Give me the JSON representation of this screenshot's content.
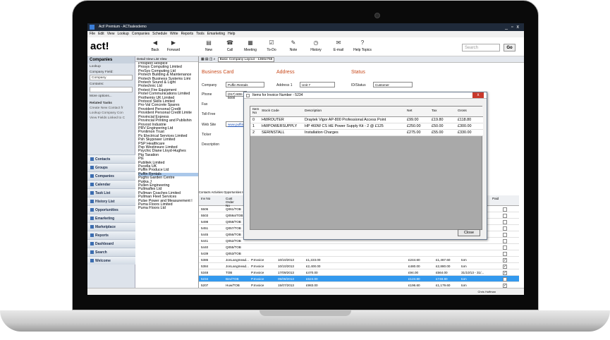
{
  "window": {
    "title": "Act! Premium - ACTsalesdemo"
  },
  "menu": [
    "File",
    "Edit",
    "View",
    "Lookup",
    "Companies",
    "Schedule",
    "Write",
    "Reports",
    "Tools",
    "Emarketing",
    "Help"
  ],
  "toolbar": {
    "logo": "act!",
    "buttons": [
      {
        "label": "Back",
        "icon": "back-arrow-icon"
      },
      {
        "label": "Forward",
        "icon": "forward-arrow-icon"
      },
      {
        "label": "New",
        "icon": "new-document-icon"
      },
      {
        "label": "Call",
        "icon": "phone-icon"
      },
      {
        "label": "Meeting",
        "icon": "meeting-icon"
      },
      {
        "label": "To-Do",
        "icon": "todo-icon"
      },
      {
        "label": "Note",
        "icon": "note-icon"
      },
      {
        "label": "History",
        "icon": "history-icon"
      },
      {
        "label": "E-mail",
        "icon": "email-icon"
      },
      {
        "label": "Help Topics",
        "icon": "help-icon"
      }
    ],
    "search_placeholder": "Search",
    "go_label": "Go"
  },
  "leftnav": {
    "header": "Companies",
    "lookup_title": "Lookup",
    "company_field_label": "Company Field:",
    "company_field_value": "Company",
    "contains_label": "Contains:",
    "more_options": "More options...",
    "related_title": "Related Tasks",
    "related": [
      "Create New Contact fr",
      "Lookup Company Con",
      "View Fields Linked to C"
    ],
    "items": [
      "Contacts",
      "Groups",
      "Companies",
      "Calendar",
      "Task List",
      "History List",
      "Opportunities",
      "Emarketing",
      "Marketplace",
      "Reports",
      "Dashboard",
      "Search",
      "Welcome"
    ]
  },
  "companies": {
    "toolbar": "Detail View  List View",
    "list": [
      "Prospect Hospice",
      "Prosys Computing Limited",
      "ProSys Computing Ltd",
      "Protech Building & Maintenance",
      "Protech Business Systems Limi",
      "Protech Sound & Light",
      "Protechnic Ltd",
      "Protect Fire Equipment",
      "Protel Communications Limited",
      "Prothemis UK Limited",
      "Protocol Skills Limited",
      "Pro-Val Concrete Spares",
      "Provident Personal Credit",
      "Provident Personal Credit Limite",
      "Provincial Express",
      "Provincial Printing and Publishin",
      "Provost Industrie",
      "PRV Engineering Ltd",
      "Prvnlimon Trust",
      "Ps Electrical Services Limited",
      "Psh Skypower Limited",
      "PSP Healthcare",
      "Psp Westinsure Limited",
      "Psychic Diane Lloyd-Hughes",
      "Ptg Taxation",
      "Pts",
      "Publitek Limited",
      "Pucella UK",
      "Puffin Produce Ltd",
      "Puffin Rentals",
      "Pughs Garden Centre",
      "Pukka J",
      "Pullen Engineering",
      "Pullmaflex Ltd",
      "Pullman Coaches Limited",
      "Pullman Fleet Services",
      "Pulse Power and Measurement l",
      "Puma Floors Limited",
      "Puma Floors Ltd"
    ],
    "selected": "Puffin Rentals"
  },
  "detail": {
    "viewbar": "Basic Company Layout - 1366x768",
    "sections": [
      "Business Card",
      "Address",
      "Status"
    ],
    "fields": {
      "company_label": "Company",
      "company_value": "Puffin Rentals",
      "phone_label": "Phone",
      "phone_value": "(017) 608-5000",
      "fax_label": "Fax",
      "tollfree_label": "Toll-Free",
      "website_label": "Web Site",
      "website_value": "www.puffinrentals",
      "ticker_label": "Ticker",
      "description_label": "Description",
      "address1_label": "Address 1",
      "address1_value": "Unit 7",
      "idstatus_label": "ID/Status",
      "idstatus_value": "Customer"
    },
    "tabs": "Contacts  Activities  Opportunities  History",
    "grid_headers": [
      "Inv No",
      "Cust Order No",
      "Paid"
    ],
    "rows": [
      {
        "inv": "5506",
        "order": "Q061/TOB",
        "paid": false
      },
      {
        "inv": "5503",
        "order": "Q059a/TOB",
        "paid": false
      },
      {
        "inv": "5498",
        "order": "Q058/TOB",
        "paid": false
      },
      {
        "inv": "5451",
        "order": "Q057/TOB",
        "paid": false
      },
      {
        "inv": "5445",
        "order": "Q056/TOB",
        "paid": false
      },
      {
        "inv": "5441",
        "order": "Q052/TOB",
        "paid": false
      },
      {
        "inv": "5440",
        "order": "Q055/TOB",
        "paid": false
      },
      {
        "inv": "5439",
        "order": "Q053/TOB",
        "paid": false
      },
      {
        "inv": "5386",
        "order": "JonLangmead...",
        "type": "P.Invoice",
        "date": "10/10/2013",
        "amt": "£1,223.00",
        "v1": "£244.60",
        "v2": "£1,467.60",
        "rep": "tom",
        "paid": true
      },
      {
        "inv": "5384",
        "order": "JonLangmead...",
        "type": "P.Invoice",
        "date": "10/10/2013",
        "amt": "£2,400.00",
        "v1": "£480.00",
        "v2": "£2,880.00",
        "rep": "tom",
        "paid": true
      },
      {
        "inv": "5348",
        "order": "TOB",
        "type": "P.Invoice",
        "date": "17/09/2013",
        "amt": "£470.00",
        "v1": "£94.00",
        "v2": "£564.00",
        "rep": "31/10/13 - 31/...",
        "paid": true
      },
      {
        "inv": "5234",
        "order": "Bev/TOB",
        "type": "P.Invoice",
        "date": "05/08/2013",
        "amt": "£624.00",
        "v1": "£124.80",
        "v2": "£748.80",
        "rep": "tom",
        "paid": true
      },
      {
        "inv": "5207",
        "order": "Huw/TOB",
        "type": "P.Invoice",
        "date": "15/07/2013",
        "amt": "£983.00",
        "v1": "£196.60",
        "v2": "£1,179.60",
        "rep": "tom",
        "paid": true
      },
      {
        "inv": "5206",
        "order": "Q046/TOB",
        "type": "P.Invoice",
        "date": "15/07/2013",
        "amt": "£1,244.91",
        "v1": "£248.98",
        "v2": "£1,493.89",
        "rep": "tom",
        "paid": true
      }
    ],
    "status_user": "Chris Huffman"
  },
  "dialog": {
    "title": "Items for Invoice Number - 5234",
    "headers": [
      "Item No",
      "Stock Code",
      "Description",
      "Net",
      "Tax",
      "Gross"
    ],
    "rows": [
      {
        "no": "0",
        "code": "HWROUTER",
        "desc": "Draytek Vigor AP-800 Professional Access Point",
        "net": "£99.00",
        "tax": "£19.80",
        "gross": "£118.80"
      },
      {
        "no": "1",
        "code": "HWPOWERSUPPLY",
        "desc": "HP 460W CS HE Power Supply Kit - 2 @ £125",
        "net": "£250.00",
        "tax": "£50.00",
        "gross": "£300.00"
      },
      {
        "no": "2",
        "code": "SERINSTALL",
        "desc": "Installation Charges",
        "net": "£275.00",
        "tax": "£55.00",
        "gross": "£330.00"
      }
    ],
    "close_label": "Close"
  }
}
